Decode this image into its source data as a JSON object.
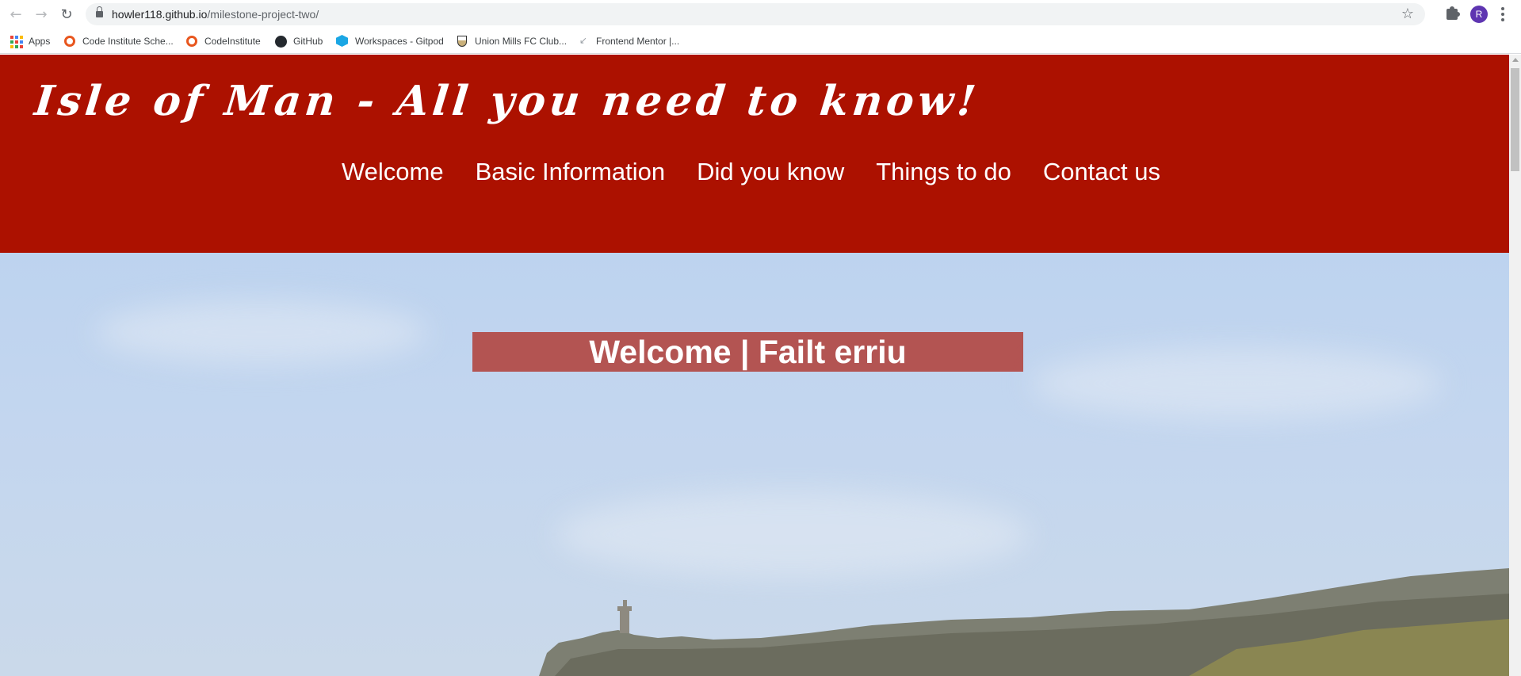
{
  "browser": {
    "url_host": "howler118.github.io",
    "url_path": "/milestone-project-two/",
    "profile_initial": "R"
  },
  "bookmarks": [
    {
      "label": "Apps",
      "icon": "apps-grid-icon"
    },
    {
      "label": "Code Institute Sche...",
      "icon": "code-institute-icon"
    },
    {
      "label": "CodeInstitute",
      "icon": "code-institute-icon"
    },
    {
      "label": "GitHub",
      "icon": "github-icon"
    },
    {
      "label": "Workspaces - Gitpod",
      "icon": "gitpod-icon"
    },
    {
      "label": "Union Mills FC Club...",
      "icon": "club-crest-icon"
    },
    {
      "label": "Frontend Mentor |...",
      "icon": "frontend-mentor-icon"
    }
  ],
  "site": {
    "title": "Isle of Man - All you need to know!",
    "nav": [
      "Welcome",
      "Basic Information",
      "Did you know",
      "Things to do",
      "Contact us"
    ],
    "hero_heading": "Welcome | Failt erriu"
  },
  "colors": {
    "header_bg": "#ac1100",
    "hero_banner_bg": "rgba(172, 17, 0, 0.66)",
    "sky": "#c3d6ef"
  }
}
